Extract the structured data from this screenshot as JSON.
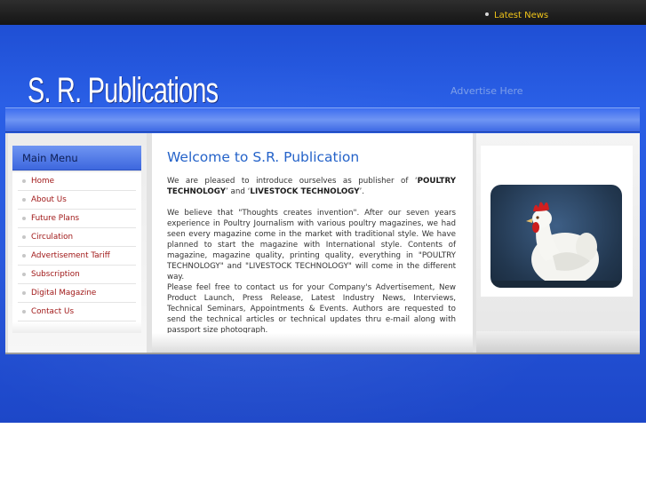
{
  "topbar": {
    "latest_news": "Latest News"
  },
  "header": {
    "logo_text": "S. R. Publications",
    "advertise": "Advertise Here"
  },
  "menu": {
    "title": "Main Menu",
    "items": [
      "Home",
      "About Us",
      "Future Plans",
      "Circulation",
      "Advertisement Tariff",
      "Subscription",
      "Digital Magazine",
      "Contact Us"
    ]
  },
  "main": {
    "title": "Welcome to S.R. Publication",
    "p1_pre": "We are pleased to introduce ourselves as publisher of ‘",
    "p1_b1": "POULTRY TECHNOLOGY",
    "p1_mid": "’ and ‘",
    "p1_b2": "LIVESTOCK TECHNOLOGY",
    "p1_post": "’.",
    "p2": "We believe that \"Thoughts creates invention\". After our seven years experience in Poultry Journalism with various poultry magazines, we had seen every magazine come in the market with traditional style. We have planned to start the magazine with International style. Contents of magazine, magazine quality, printing quality, everything in \"POULTRY TECHNOLOGY\" and \"LIVESTOCK TECHNOLOGY\" will come in the different way.",
    "p3": "Please feel free to contact us for your Company's Advertisement, New Product Launch, Press Release, Latest Industry News, Interviews, Technical Seminars, Appointments & Events. Authors are requested to send the technical articles or technical updates thru e-mail along with passport size photograph."
  },
  "colors": {
    "brand_blue": "#2a5fe6",
    "title_blue": "#2563c9",
    "menu_link": "#a01818",
    "news_yellow": "#f0c419"
  }
}
